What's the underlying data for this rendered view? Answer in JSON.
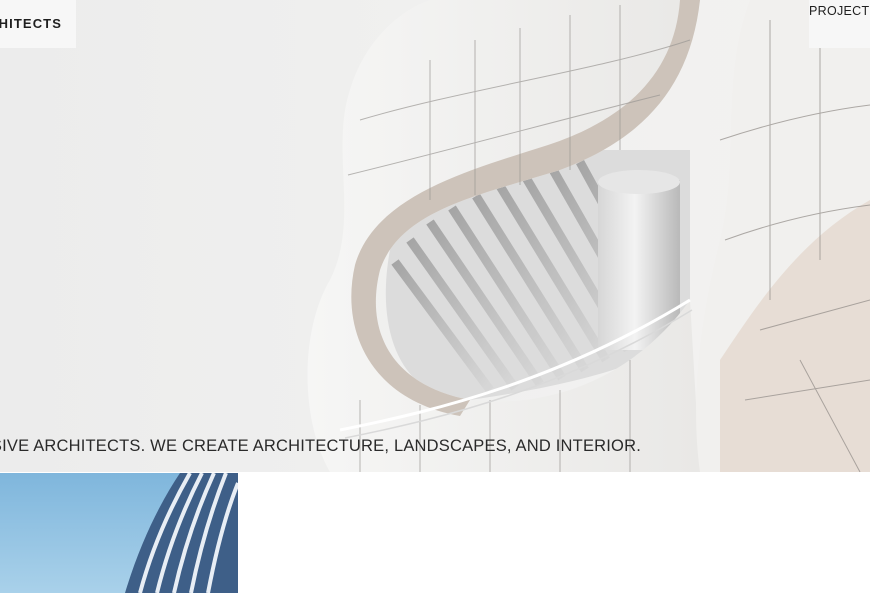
{
  "header": {
    "brand_text": "ARCHITECTS",
    "nav": {
      "projects_label": "PROJECTS"
    }
  },
  "hero": {
    "image_icon": "architecture-curves-image",
    "tagline": "COMPREHENSIVE ARCHITECTS. WE CREATE ARCHITECTURE, LANDSCAPES, AND INTERIOR."
  },
  "projects": {
    "thumbnail_icon": "building-facade-image"
  },
  "colors": {
    "hero_bg": "#eeeeee",
    "facade_tile": "#f4f3f1",
    "facade_shadow": "#c9beb5",
    "sky": "#8fc0e0",
    "text": "#1f1f1f"
  }
}
